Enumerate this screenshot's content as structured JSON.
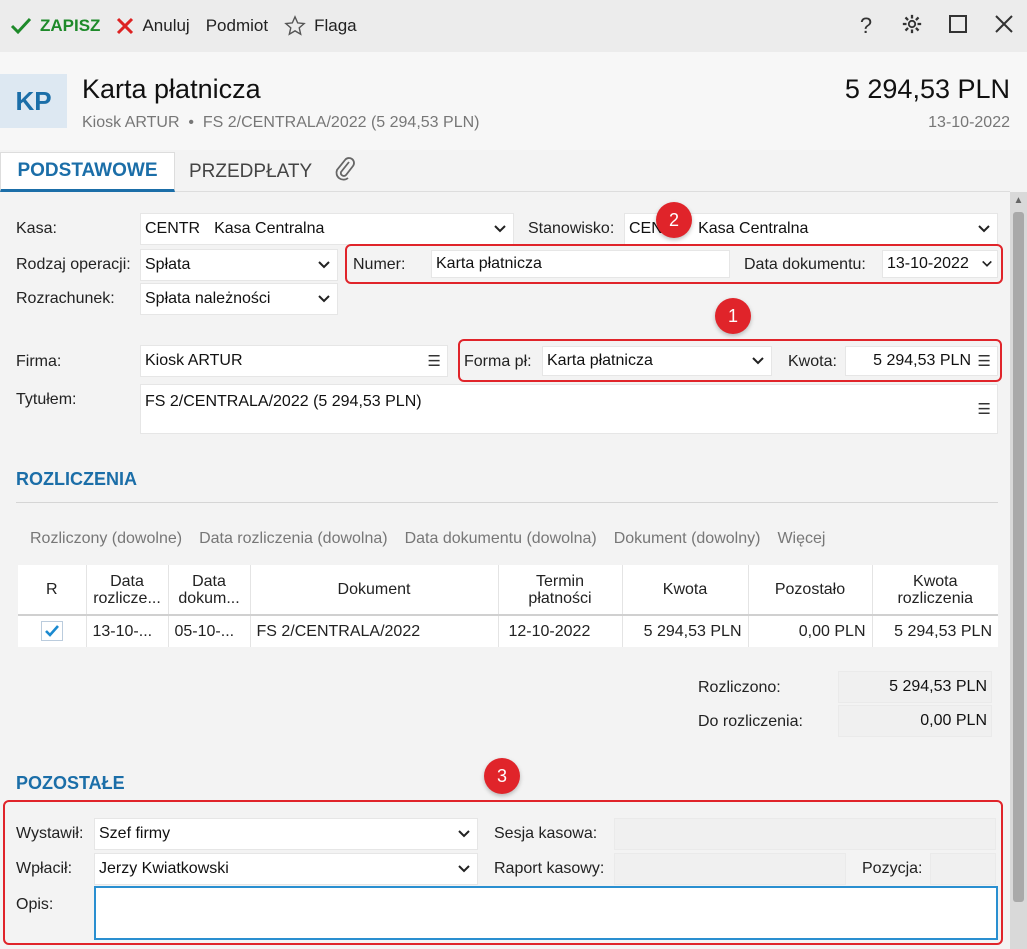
{
  "toolbar": {
    "save_label": "ZAPISZ",
    "cancel_label": "Anuluj",
    "subject_label": "Podmiot",
    "flag_label": "Flaga",
    "help_label": "?"
  },
  "header": {
    "avatar": "KP",
    "title": "Karta płatnicza",
    "subtitle": "Kiosk ARTUR  •  FS 2/CENTRALA/2022 (5 294,53 PLN)",
    "amount": "5 294,53 PLN",
    "date": "13-10-2022"
  },
  "tabs": [
    {
      "label": "PODSTAWOWE"
    },
    {
      "label": "PRZEDPŁATY"
    }
  ],
  "form": {
    "kasa_label": "Kasa:",
    "kasa_code": "CENTR",
    "kasa_value": "Kasa Centralna",
    "stanowisko_label": "Stanowisko:",
    "stanowisko_code": "CENTR",
    "stanowisko_value": "Kasa Centralna",
    "rodzaj_label": "Rodzaj operacji:",
    "rodzaj_value": "Spłata",
    "numer_label": "Numer:",
    "numer_value": "Karta płatnicza",
    "data_dok_label": "Data dokumentu:",
    "data_dok_value": "13-10-2022",
    "rozrachunek_label": "Rozrachunek:",
    "rozrachunek_value": "Spłata należności",
    "firma_label": "Firma:",
    "firma_value": "Kiosk ARTUR",
    "forma_label": "Forma pł:",
    "forma_value": "Karta płatnicza",
    "kwota_label": "Kwota:",
    "kwota_value": "5 294,53 PLN",
    "tytulem_label": "Tytułem:",
    "tytulem_value": "FS 2/CENTRALA/2022 (5 294,53 PLN)"
  },
  "rozliczenia": {
    "title": "ROZLICZENIA",
    "filters": [
      "Rozliczony (dowolne)",
      "Data rozliczenia (dowolna)",
      "Data dokumentu (dowolna)",
      "Dokument (dowolny)",
      "Więcej"
    ],
    "columns": [
      "R",
      "Data rozlicze...",
      "Data dokum...",
      "Dokument",
      "Termin płatności",
      "Kwota",
      "Pozostało",
      "Kwota rozliczenia"
    ],
    "rows": [
      {
        "data_rozl": "13-10-...",
        "data_dok": "05-10-...",
        "dokument": "FS 2/CENTRALA/2022",
        "termin": "12-10-2022",
        "kwota": "5 294,53 PLN",
        "pozostalo": "0,00 PLN",
        "kwota_rozl": "5 294,53 PLN"
      }
    ],
    "rozliczono_label": "Rozliczono:",
    "rozliczono_value": "5 294,53 PLN",
    "do_rozl_label": "Do rozliczenia:",
    "do_rozl_value": "0,00 PLN"
  },
  "pozostale": {
    "title": "POZOSTAŁE",
    "wystawil_label": "Wystawił:",
    "wystawil_value": "Szef firmy",
    "sesja_label": "Sesja kasowa:",
    "wplacil_label": "Wpłacił:",
    "wplacil_value": "Jerzy Kwiatkowski",
    "raport_label": "Raport kasowy:",
    "pozycja_label": "Pozycja:",
    "opis_label": "Opis:"
  },
  "annotations": {
    "badge1": "1",
    "badge2": "2",
    "badge3": "3",
    "color": "#e0242a"
  }
}
